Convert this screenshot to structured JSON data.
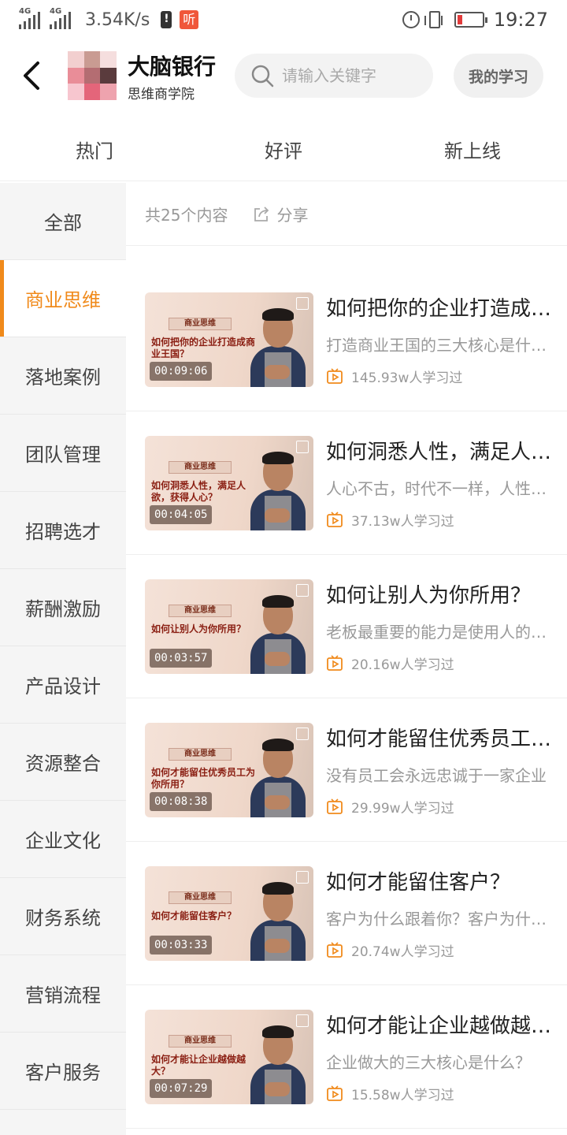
{
  "status_bar": {
    "signal_1": "4G",
    "signal_2": "4G",
    "speed": "3.54K/s",
    "app_badge": "听",
    "time": "19:27"
  },
  "header": {
    "brand_name": "大脑银行",
    "brand_sub": "思维商学院",
    "search_placeholder": "请输入关键字",
    "my_study_label": "我的学习"
  },
  "top_tabs": [
    {
      "label": "热门"
    },
    {
      "label": "好评"
    },
    {
      "label": "新上线"
    }
  ],
  "sidebar": {
    "items": [
      {
        "label": "全部"
      },
      {
        "label": "商业思维"
      },
      {
        "label": "落地案例"
      },
      {
        "label": "团队管理"
      },
      {
        "label": "招聘选才"
      },
      {
        "label": "薪酬激励"
      },
      {
        "label": "产品设计"
      },
      {
        "label": "资源整合"
      },
      {
        "label": "企业文化"
      },
      {
        "label": "财务系统"
      },
      {
        "label": "营销流程"
      },
      {
        "label": "客户服务"
      }
    ],
    "active_index": 1
  },
  "content": {
    "count_label": "共25个内容",
    "share_label": "分享",
    "courses": [
      {
        "title": "如何把你的企业打造成商业王国？",
        "desc": "打造商业王国的三大核心是什么？",
        "views": "145.93w人学习过",
        "duration": "00:09:06",
        "thumb_tag": "商业思维",
        "thumb_title": "如何把你的企业打造成商业王国？"
      },
      {
        "title": "如何洞悉人性，满足人欲，获得人心？",
        "desc": "人心不古，时代不一样，人性的需求也不同",
        "views": "37.13w人学习过",
        "duration": "00:04:05",
        "thumb_tag": "商业思维",
        "thumb_title": "如何洞悉人性，满足人欲，获得人心？"
      },
      {
        "title": "如何让别人为你所用？",
        "desc": "老板最重要的能力是使用人的能力",
        "views": "20.16w人学习过",
        "duration": "00:03:57",
        "thumb_tag": "商业思维",
        "thumb_title": "如何让别人为你所用？"
      },
      {
        "title": "如何才能留住优秀员工为你所用？",
        "desc": "没有员工会永远忠诚于一家企业",
        "views": "29.99w人学习过",
        "duration": "00:08:38",
        "thumb_tag": "商业思维",
        "thumb_title": "如何才能留住优秀员工为你所用？"
      },
      {
        "title": "如何才能留住客户？",
        "desc": "客户为什么跟着你？客户为什么离开你？",
        "views": "20.74w人学习过",
        "duration": "00:03:33",
        "thumb_tag": "商业思维",
        "thumb_title": "如何才能留住客户？"
      },
      {
        "title": "如何才能让企业越做越大？",
        "desc": "企业做大的三大核心是什么？",
        "views": "15.58w人学习过",
        "duration": "00:07:29",
        "thumb_tag": "商业思维",
        "thumb_title": "如何才能让企业越做越大？"
      }
    ]
  },
  "colors": {
    "accent": "#f08a1b",
    "sidebar_bg": "#f5f5f5"
  }
}
